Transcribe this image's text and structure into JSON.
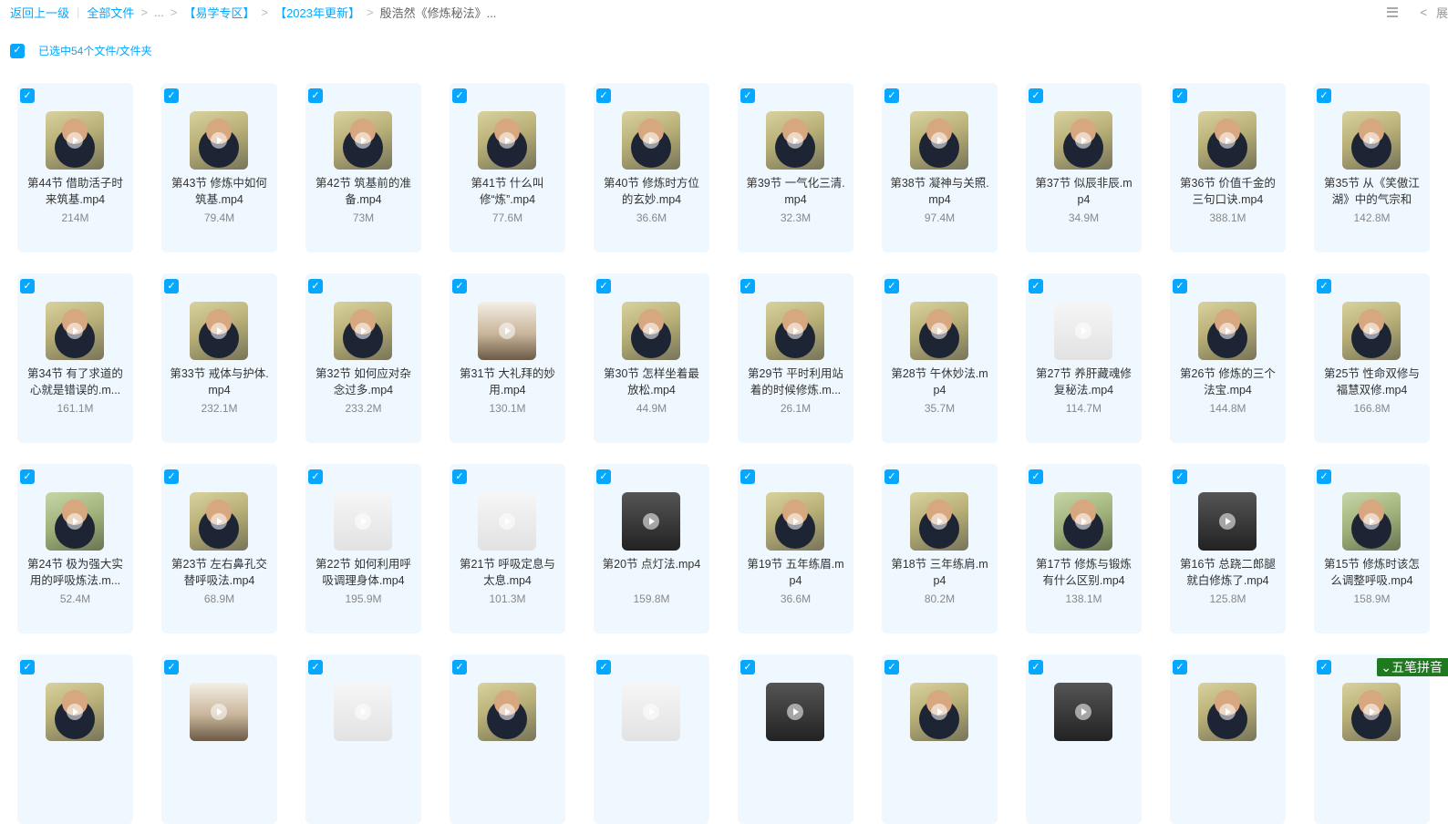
{
  "breadcrumb": {
    "back": "返回上一级",
    "all": "全部文件",
    "ellipsis": "...",
    "c1": "【易学专区】",
    "c2": "【2023年更新】",
    "current": "殷浩然《修炼秘法》..."
  },
  "top_right": {
    "collapse": "展"
  },
  "selection": {
    "label": "已选中54个文件/文件夹"
  },
  "ime": {
    "label": "五笔拼音"
  },
  "files": [
    {
      "name": "第44节 借助活子时来筑基.mp4",
      "size": "214M",
      "thumb": "person"
    },
    {
      "name": "第43节 修炼中如何筑基.mp4",
      "size": "79.4M",
      "thumb": "person"
    },
    {
      "name": "第42节 筑基前的准备.mp4",
      "size": "73M",
      "thumb": "person"
    },
    {
      "name": "第41节 什么叫修“炼”.mp4",
      "size": "77.6M",
      "thumb": "person"
    },
    {
      "name": "第40节 修炼时方位的玄妙.mp4",
      "size": "36.6M",
      "thumb": "person"
    },
    {
      "name": "第39节 一气化三清.mp4",
      "size": "32.3M",
      "thumb": "person"
    },
    {
      "name": "第38节 凝神与关照.mp4",
      "size": "97.4M",
      "thumb": "person"
    },
    {
      "name": "第37节 似辰非辰.mp4",
      "size": "34.9M",
      "thumb": "person"
    },
    {
      "name": "第36节 价值千金的三句口诀.mp4",
      "size": "388.1M",
      "thumb": "person"
    },
    {
      "name": "第35节 从《笑傲江湖》中的气宗和",
      "size": "142.8M",
      "thumb": "person"
    },
    {
      "name": "第34节 有了求道的心就是错误的.m...",
      "size": "161.1M",
      "thumb": "person"
    },
    {
      "name": "第33节 戒体与护体.mp4",
      "size": "232.1M",
      "thumb": "person"
    },
    {
      "name": "第32节 如何应对杂念过多.mp4",
      "size": "233.2M",
      "thumb": "person"
    },
    {
      "name": "第31节 大礼拜的妙用.mp4",
      "size": "130.1M",
      "thumb": "room"
    },
    {
      "name": "第30节 怎样坐着最放松.mp4",
      "size": "44.9M",
      "thumb": "person"
    },
    {
      "name": "第29节 平时利用站着的时候修炼.m...",
      "size": "26.1M",
      "thumb": "person"
    },
    {
      "name": "第28节 午休妙法.mp4",
      "size": "35.7M",
      "thumb": "person"
    },
    {
      "name": "第27节 养肝藏魂修复秘法.mp4",
      "size": "114.7M",
      "thumb": "light"
    },
    {
      "name": "第26节 修炼的三个法宝.mp4",
      "size": "144.8M",
      "thumb": "person"
    },
    {
      "name": "第25节 性命双修与福慧双修.mp4",
      "size": "166.8M",
      "thumb": "person"
    },
    {
      "name": "第24节 极为强大实用的呼吸炼法.m...",
      "size": "52.4M",
      "thumb": "green"
    },
    {
      "name": "第23节 左右鼻孔交替呼吸法.mp4",
      "size": "68.9M",
      "thumb": "person"
    },
    {
      "name": "第22节 如何利用呼吸调理身体.mp4",
      "size": "195.9M",
      "thumb": "light"
    },
    {
      "name": "第21节 呼吸定息与太息.mp4",
      "size": "101.3M",
      "thumb": "light"
    },
    {
      "name": "第20节 点灯法.mp4",
      "size": "159.8M",
      "thumb": "dark"
    },
    {
      "name": "第19节 五年练眉.mp4",
      "size": "36.6M",
      "thumb": "person"
    },
    {
      "name": "第18节 三年练肩.mp4",
      "size": "80.2M",
      "thumb": "person"
    },
    {
      "name": "第17节 修炼与锻炼有什么区别.mp4",
      "size": "138.1M",
      "thumb": "green"
    },
    {
      "name": "第16节 总跷二郎腿就白修炼了.mp4",
      "size": "125.8M",
      "thumb": "dark"
    },
    {
      "name": "第15节 修炼时该怎么调整呼吸.mp4",
      "size": "158.9M",
      "thumb": "green"
    },
    {
      "name": "",
      "size": "",
      "thumb": "person"
    },
    {
      "name": "",
      "size": "",
      "thumb": "room"
    },
    {
      "name": "",
      "size": "",
      "thumb": "light"
    },
    {
      "name": "",
      "size": "",
      "thumb": "person"
    },
    {
      "name": "",
      "size": "",
      "thumb": "light"
    },
    {
      "name": "",
      "size": "",
      "thumb": "dark"
    },
    {
      "name": "",
      "size": "",
      "thumb": "person"
    },
    {
      "name": "",
      "size": "",
      "thumb": "dark"
    },
    {
      "name": "",
      "size": "",
      "thumb": "person"
    },
    {
      "name": "",
      "size": "",
      "thumb": "person"
    }
  ]
}
